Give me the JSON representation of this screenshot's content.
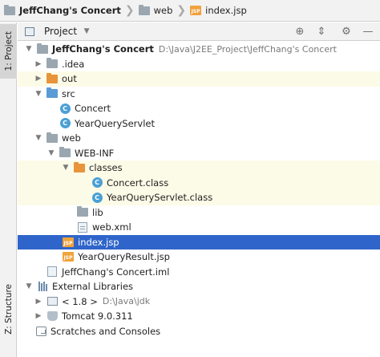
{
  "breadcrumb": {
    "items": [
      {
        "label": "JeffChang's Concert",
        "icon": "project-folder-icon"
      },
      {
        "label": "web",
        "icon": "web-folder-icon"
      },
      {
        "label": "index.jsp",
        "icon": "jsp-file-icon"
      }
    ]
  },
  "left_strip": {
    "project_tab": "1: Project",
    "structure_tab": "Z: Structure"
  },
  "panel": {
    "title": "Project",
    "header_icons": [
      "target-icon",
      "collapse-all-icon",
      "settings-icon",
      "hide-icon"
    ]
  },
  "tree": {
    "root": {
      "label": "JeffChang's Concert",
      "path": "D:\\Java\\J2EE_Project\\JeffChang's Concert"
    },
    "idea": ".idea",
    "out": "out",
    "src": "src",
    "concert": "Concert",
    "yearqueryservlet": "YearQueryServlet",
    "web": "web",
    "webinf": "WEB-INF",
    "classes": "classes",
    "concert_class": "Concert.class",
    "yearqueryservlet_class": "YearQueryServlet.class",
    "lib": "lib",
    "webxml": "web.xml",
    "indexjsp": "index.jsp",
    "yearqueryresult": "YearQueryResult.jsp",
    "iml": "JeffChang's Concert.iml",
    "extlibs": "External Libraries",
    "jdk": "< 1.8 >",
    "jdk_path": "D:\\Java\\jdk",
    "tomcat": "Tomcat 9.0.311",
    "scratches": "Scratches and Consoles"
  },
  "colors": {
    "selection": "#2f65ca",
    "highlight_row": "#fcfbe7",
    "excluded_folder": "#e8943a",
    "source_folder": "#5a9bd6"
  }
}
